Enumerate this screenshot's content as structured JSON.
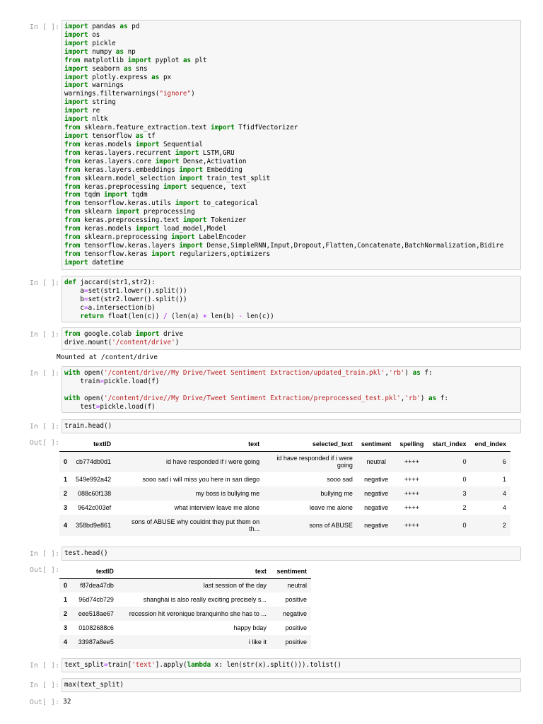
{
  "prompts": {
    "in": "In [ ]:",
    "out": "Out[ ]:"
  },
  "cell1": {
    "lines": [
      [
        [
          "kw",
          "import"
        ],
        [
          "t",
          " pandas "
        ],
        [
          "kw",
          "as"
        ],
        [
          "t",
          " pd"
        ]
      ],
      [
        [
          "kw",
          "import"
        ],
        [
          "t",
          " os"
        ]
      ],
      [
        [
          "kw",
          "import"
        ],
        [
          "t",
          " pickle"
        ]
      ],
      [
        [
          "kw",
          "import"
        ],
        [
          "t",
          " numpy "
        ],
        [
          "kw",
          "as"
        ],
        [
          "t",
          " np"
        ]
      ],
      [
        [
          "kw",
          "from"
        ],
        [
          "t",
          " matplotlib "
        ],
        [
          "kw",
          "import"
        ],
        [
          "t",
          " pyplot "
        ],
        [
          "kw",
          "as"
        ],
        [
          "t",
          " plt"
        ]
      ],
      [
        [
          "kw",
          "import"
        ],
        [
          "t",
          " seaborn "
        ],
        [
          "kw",
          "as"
        ],
        [
          "t",
          " sns"
        ]
      ],
      [
        [
          "kw",
          "import"
        ],
        [
          "t",
          " plotly.express "
        ],
        [
          "kw",
          "as"
        ],
        [
          "t",
          " px"
        ]
      ],
      [
        [
          "kw",
          "import"
        ],
        [
          "t",
          " warnings"
        ]
      ],
      [
        [
          "t",
          "warnings.filterwarnings("
        ],
        [
          "str",
          "\"ignore\""
        ],
        [
          "t",
          ")"
        ]
      ],
      [
        [
          "kw",
          "import"
        ],
        [
          "t",
          " string"
        ]
      ],
      [
        [
          "kw",
          "import"
        ],
        [
          "t",
          " re"
        ]
      ],
      [
        [
          "kw",
          "import"
        ],
        [
          "t",
          " nltk"
        ]
      ],
      [
        [
          "kw",
          "from"
        ],
        [
          "t",
          " sklearn.feature_extraction.text "
        ],
        [
          "kw",
          "import"
        ],
        [
          "t",
          " TfidfVectorizer"
        ]
      ],
      [
        [
          "kw",
          "import"
        ],
        [
          "t",
          " tensorflow "
        ],
        [
          "kw",
          "as"
        ],
        [
          "t",
          " tf"
        ]
      ],
      [
        [
          "kw",
          "from"
        ],
        [
          "t",
          " keras.models "
        ],
        [
          "kw",
          "import"
        ],
        [
          "t",
          " Sequential"
        ]
      ],
      [
        [
          "kw",
          "from"
        ],
        [
          "t",
          " keras.layers.recurrent "
        ],
        [
          "kw",
          "import"
        ],
        [
          "t",
          " LSTM,GRU"
        ]
      ],
      [
        [
          "kw",
          "from"
        ],
        [
          "t",
          " keras.layers.core "
        ],
        [
          "kw",
          "import"
        ],
        [
          "t",
          " Dense,Activation"
        ]
      ],
      [
        [
          "kw",
          "from"
        ],
        [
          "t",
          " keras.layers.embeddings "
        ],
        [
          "kw",
          "import"
        ],
        [
          "t",
          " Embedding"
        ]
      ],
      [
        [
          "kw",
          "from"
        ],
        [
          "t",
          " sklearn.model_selection "
        ],
        [
          "kw",
          "import"
        ],
        [
          "t",
          " train_test_split"
        ]
      ],
      [
        [
          "kw",
          "from"
        ],
        [
          "t",
          " keras.preprocessing "
        ],
        [
          "kw",
          "import"
        ],
        [
          "t",
          " sequence, text"
        ]
      ],
      [
        [
          "kw",
          "from"
        ],
        [
          "t",
          " tqdm "
        ],
        [
          "kw",
          "import"
        ],
        [
          "t",
          " tqdm"
        ]
      ],
      [
        [
          "kw",
          "from"
        ],
        [
          "t",
          " tensorflow.keras.utils "
        ],
        [
          "kw",
          "import"
        ],
        [
          "t",
          " to_categorical"
        ]
      ],
      [
        [
          "kw",
          "from"
        ],
        [
          "t",
          " sklearn "
        ],
        [
          "kw",
          "import"
        ],
        [
          "t",
          " preprocessing"
        ]
      ],
      [
        [
          "kw",
          "from"
        ],
        [
          "t",
          " keras.preprocessing.text "
        ],
        [
          "kw",
          "import"
        ],
        [
          "t",
          " Tokenizer"
        ]
      ],
      [
        [
          "kw",
          "from"
        ],
        [
          "t",
          " keras.models "
        ],
        [
          "kw",
          "import"
        ],
        [
          "t",
          " load_model,Model"
        ]
      ],
      [
        [
          "kw",
          "from"
        ],
        [
          "t",
          " sklearn.preprocessing "
        ],
        [
          "kw",
          "import"
        ],
        [
          "t",
          " LabelEncoder"
        ]
      ],
      [
        [
          "kw",
          "from"
        ],
        [
          "t",
          " tensorflow.keras.layers "
        ],
        [
          "kw",
          "import"
        ],
        [
          "t",
          " Dense,SimpleRNN,Input,Dropout,Flatten,Concatenate,BatchNormalization,Bidire"
        ]
      ],
      [
        [
          "kw",
          "from"
        ],
        [
          "t",
          " tensorflow.keras "
        ],
        [
          "kw",
          "import"
        ],
        [
          "t",
          " regularizers,optimizers"
        ]
      ],
      [
        [
          "kw",
          "import"
        ],
        [
          "t",
          " datetime"
        ]
      ]
    ]
  },
  "cell2": {
    "lines": [
      [
        [
          "kw",
          "def"
        ],
        [
          "t",
          " jaccard(str1,str2):"
        ]
      ],
      [
        [
          "t",
          "    a"
        ],
        [
          "op",
          "="
        ],
        [
          "t",
          "set(str1.lower().split())"
        ]
      ],
      [
        [
          "t",
          "    b"
        ],
        [
          "op",
          "="
        ],
        [
          "t",
          "set(str2.lower().split())"
        ]
      ],
      [
        [
          "t",
          "    c"
        ],
        [
          "op",
          "="
        ],
        [
          "t",
          "a.intersection(b)"
        ]
      ],
      [
        [
          "t",
          "    "
        ],
        [
          "kw",
          "return"
        ],
        [
          "t",
          " float(len(c)) "
        ],
        [
          "op",
          "/"
        ],
        [
          "t",
          " (len(a) "
        ],
        [
          "op",
          "+"
        ],
        [
          "t",
          " len(b) "
        ],
        [
          "op",
          "-"
        ],
        [
          "t",
          " len(c))"
        ]
      ]
    ]
  },
  "cell3": {
    "lines": [
      [
        [
          "kw",
          "from"
        ],
        [
          "t",
          " google.colab "
        ],
        [
          "kw",
          "import"
        ],
        [
          "t",
          " drive"
        ]
      ],
      [
        [
          "t",
          "drive.mount("
        ],
        [
          "str",
          "'/content/drive'"
        ],
        [
          "t",
          ")"
        ]
      ]
    ],
    "output": "Mounted at /content/drive"
  },
  "cell4": {
    "lines": [
      [
        [
          "kw",
          "with"
        ],
        [
          "t",
          " open("
        ],
        [
          "str",
          "'/content/drive//My Drive/Tweet Sentiment Extraction/updated_train.pkl'"
        ],
        [
          "t",
          ","
        ],
        [
          "str",
          "'rb'"
        ],
        [
          "t",
          ") "
        ],
        [
          "kw",
          "as"
        ],
        [
          "t",
          " f:"
        ]
      ],
      [
        [
          "t",
          "    train"
        ],
        [
          "op",
          "="
        ],
        [
          "t",
          "pickle.load(f)"
        ]
      ],
      [
        [
          "t",
          ""
        ]
      ],
      [
        [
          "kw",
          "with"
        ],
        [
          "t",
          " open("
        ],
        [
          "str",
          "'/content/drive//My Drive/Tweet Sentiment Extraction/preprocessed_test.pkl'"
        ],
        [
          "t",
          ","
        ],
        [
          "str",
          "'rb'"
        ],
        [
          "t",
          ") "
        ],
        [
          "kw",
          "as"
        ],
        [
          "t",
          " f:"
        ]
      ],
      [
        [
          "t",
          "    test"
        ],
        [
          "op",
          "="
        ],
        [
          "t",
          "pickle.load(f)"
        ]
      ]
    ]
  },
  "cell5": {
    "lines": [
      [
        [
          "t",
          "train.head()"
        ]
      ]
    ],
    "table": {
      "headers": [
        "",
        "textID",
        "text",
        "selected_text",
        "sentiment",
        "spelling",
        "start_index",
        "end_index"
      ],
      "rows": [
        [
          "0",
          "cb774db0d1",
          "id have responded if i were going",
          "id have responded if i were going",
          "neutral",
          "++++",
          "0",
          "6"
        ],
        [
          "1",
          "549e992a42",
          "sooo sad i will miss you here in san diego",
          "sooo sad",
          "negative",
          "++++",
          "0",
          "1"
        ],
        [
          "2",
          "088c60f138",
          "my boss is bullying me",
          "bullying me",
          "negative",
          "++++",
          "3",
          "4"
        ],
        [
          "3",
          "9642c003ef",
          "what interview leave me alone",
          "leave me alone",
          "negative",
          "++++",
          "2",
          "4"
        ],
        [
          "4",
          "358bd9e861",
          "sons of ABUSE why couldnt they put them on th...",
          "sons of ABUSE",
          "negative",
          "++++",
          "0",
          "2"
        ]
      ]
    }
  },
  "cell6": {
    "lines": [
      [
        [
          "t",
          "test.head()"
        ]
      ]
    ],
    "table": {
      "headers": [
        "",
        "textID",
        "text",
        "sentiment"
      ],
      "rows": [
        [
          "0",
          "f87dea47db",
          "last session of the day",
          "neutral"
        ],
        [
          "1",
          "96d74cb729",
          "shanghai is also really exciting precisely s...",
          "positive"
        ],
        [
          "2",
          "eee518ae67",
          "recession hit veronique branquinho she has to ...",
          "negative"
        ],
        [
          "3",
          "01082688c6",
          "happy bday",
          "positive"
        ],
        [
          "4",
          "33987a8ee5",
          "i like it",
          "positive"
        ]
      ]
    }
  },
  "cell7": {
    "lines": [
      [
        [
          "t",
          "text_split"
        ],
        [
          "op",
          "="
        ],
        [
          "t",
          "train["
        ],
        [
          "str",
          "'text'"
        ],
        [
          "t",
          "].apply("
        ],
        [
          "kw",
          "lambda"
        ],
        [
          "t",
          " x: len(str(x).split())).tolist()"
        ]
      ]
    ]
  },
  "cell8": {
    "lines": [
      [
        [
          "t",
          "max(text_split)"
        ]
      ]
    ],
    "output": "32"
  }
}
